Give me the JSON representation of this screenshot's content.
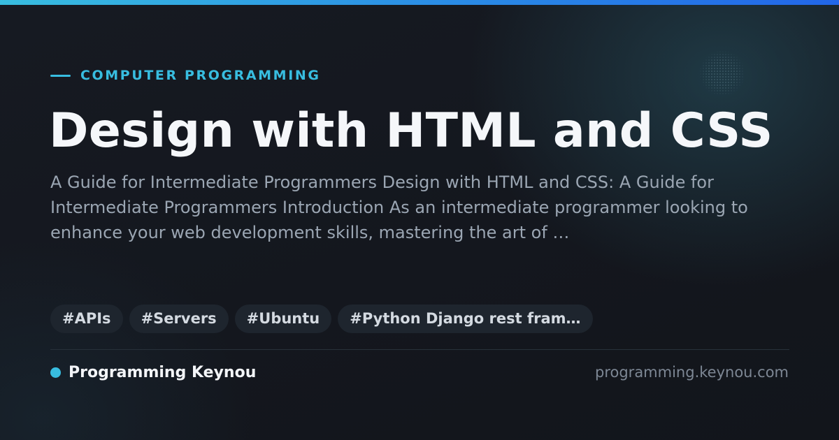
{
  "colors": {
    "accent": "#38bde0",
    "accent_gradient_end": "#2266e8",
    "background": "#14171e",
    "title": "#f5f7fa",
    "body_text": "#9ba6b3",
    "tag_background": "#1e252e",
    "muted": "#7d8794"
  },
  "category": {
    "label": "COMPUTER PROGRAMMING"
  },
  "article": {
    "title": "Design with HTML and CSS",
    "description": "A Guide for Intermediate Programmers Design with HTML and CSS: A Guide for Intermediate Programmers Introduction As an intermediate programmer looking to enhance your web development skills, mastering the art of …"
  },
  "tags": [
    {
      "label": "#APIs"
    },
    {
      "label": "#Servers"
    },
    {
      "label": "#Ubuntu"
    },
    {
      "label": "#Python Django rest fram…"
    }
  ],
  "footer": {
    "brand_name": "Programming Keynou",
    "url": "programming.keynou.com"
  }
}
